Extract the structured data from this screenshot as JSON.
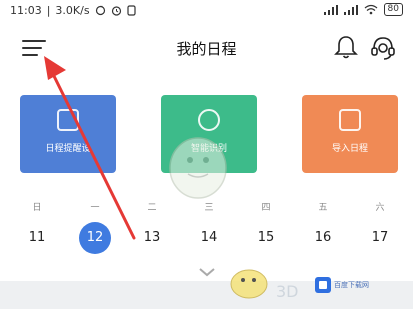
{
  "status_bar": {
    "time": "11:03",
    "speed": "3.0K/s",
    "battery": "80"
  },
  "header": {
    "title": "我的日程"
  },
  "cards": [
    {
      "label": "日程提醒设",
      "color": "#4f7fd6"
    },
    {
      "label": "智能识别",
      "color": "#3dbb8a"
    },
    {
      "label": "导入日程",
      "color": "#f08a55"
    }
  ],
  "calendar": {
    "weekdays": [
      "日",
      "一",
      "二",
      "三",
      "四",
      "五",
      "六"
    ],
    "dates": [
      "11",
      "12",
      "13",
      "14",
      "15",
      "16",
      "17"
    ],
    "selected_index": 1
  },
  "watermark": {
    "brand": "3D",
    "site_name": "百度下载网"
  },
  "colors": {
    "accent_blue": "#3f7be0",
    "arrow_red": "#e53935"
  }
}
